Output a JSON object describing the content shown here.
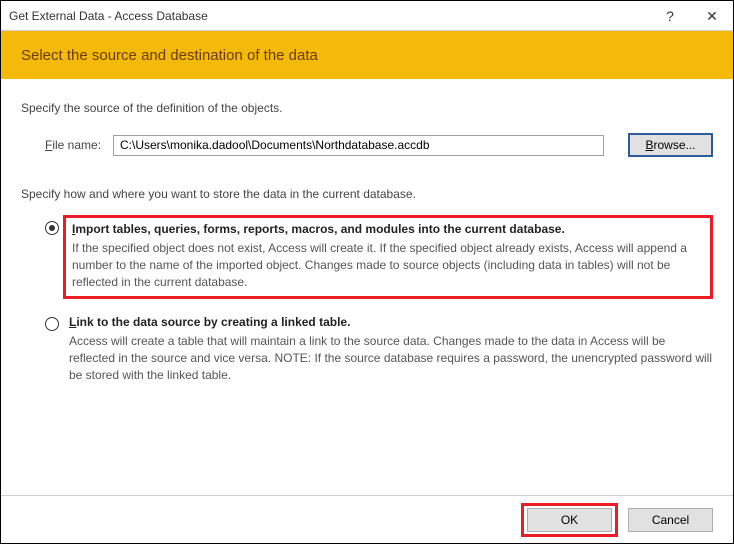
{
  "window": {
    "title": "Get External Data - Access Database",
    "help_symbol": "?",
    "close_symbol": "✕"
  },
  "header": {
    "title": "Select the source and destination of the data"
  },
  "source_section": {
    "label": "Specify the source of the definition of the objects.",
    "filename_label_prefix": "F",
    "filename_label_rest": "ile name:",
    "filename_value": "C:\\Users\\monika.dadool\\Documents\\Northdatabase.accdb",
    "browse_label_prefix": "B",
    "browse_label_rest": "rowse..."
  },
  "store_section": {
    "label": "Specify how and where you want to store the data in the current database.",
    "options": [
      {
        "title_u": "I",
        "title_rest": "mport tables, queries, forms, reports, macros, and modules into the current database.",
        "desc": "If the specified object does not exist, Access will create it. If the specified object already exists, Access will append a number to the name of the imported object. Changes made to source objects (including data in tables) will not be reflected in the current database.",
        "checked": true,
        "highlighted": true
      },
      {
        "title_u": "L",
        "title_rest": "ink to the data source by creating a linked table.",
        "desc": "Access will create a table that will maintain a link to the source data. Changes made to the data in Access will be reflected in the source and vice versa. NOTE:  If the source database requires a password, the unencrypted password will be stored with the linked table.",
        "checked": false,
        "highlighted": false
      }
    ]
  },
  "footer": {
    "ok_label": "OK",
    "cancel_label": "Cancel"
  }
}
